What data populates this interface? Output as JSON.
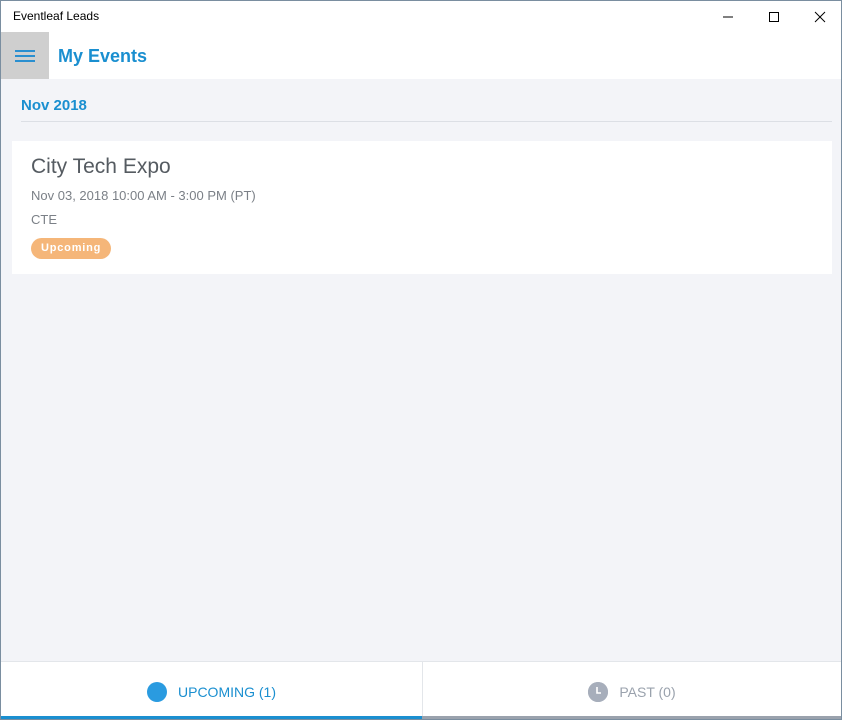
{
  "window": {
    "title": "Eventleaf Leads"
  },
  "header": {
    "menu_icon": "hamburger-menu-icon",
    "page_title": "My Events"
  },
  "events_section": {
    "month": "Nov 2018",
    "events": [
      {
        "title": "City Tech Expo",
        "datetime": "Nov 03, 2018 10:00 AM - 3:00 PM (PT)",
        "code": "CTE",
        "status": "Upcoming"
      }
    ]
  },
  "tabs": [
    {
      "label": "UPCOMING (1)",
      "icon": "upcoming-dot-icon",
      "active": true
    },
    {
      "label": "PAST (0)",
      "icon": "clock-icon",
      "active": false
    }
  ],
  "colors": {
    "accent": "#1a8fd0",
    "badge": "#f5b679",
    "content_bg": "#f3f4f8",
    "inactive_tab": "#9aa2ad"
  }
}
